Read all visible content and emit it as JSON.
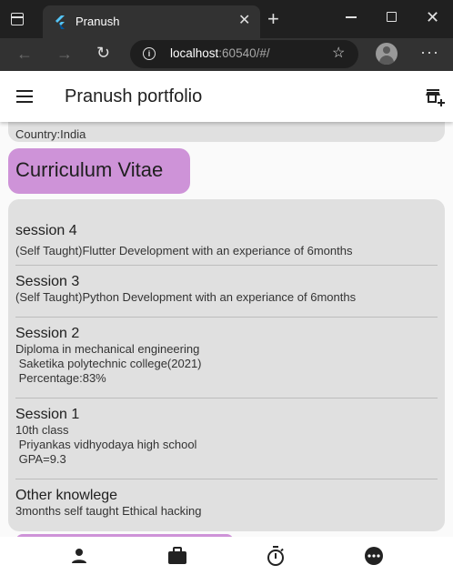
{
  "browser": {
    "tab_title": "Pranush",
    "url_host": "localhost",
    "url_rest": ":60540/#/"
  },
  "app": {
    "title": "Pranush portfolio",
    "previous_card_text": "Country:India",
    "cv_heading": "Curriculum Vitae",
    "entries": [
      {
        "title": "session 4",
        "body": "(Self Taught)Flutter Development with an experiance of 6months"
      },
      {
        "title": "Session 3",
        "body": "(Self Taught)Python Development with an experiance of 6months"
      },
      {
        "title": "Session 2",
        "body": "Diploma in mechanical engineering\n Saketika polytechnic college(2021)\n Percentage:83%"
      },
      {
        "title": "Session 1",
        "body": "10th class\n Priyankas vidhyodaya high school\n GPA=9.3"
      },
      {
        "title": "Other knowlege",
        "body": "3months self taught Ethical hacking"
      }
    ]
  },
  "colors": {
    "accent": "#ce93d8",
    "card": "#e0e0e0",
    "background": "#fafafa"
  },
  "icons": {
    "bottom_nav": [
      "person-icon",
      "briefcase-icon",
      "stopwatch-icon",
      "more-circle-icon"
    ]
  }
}
